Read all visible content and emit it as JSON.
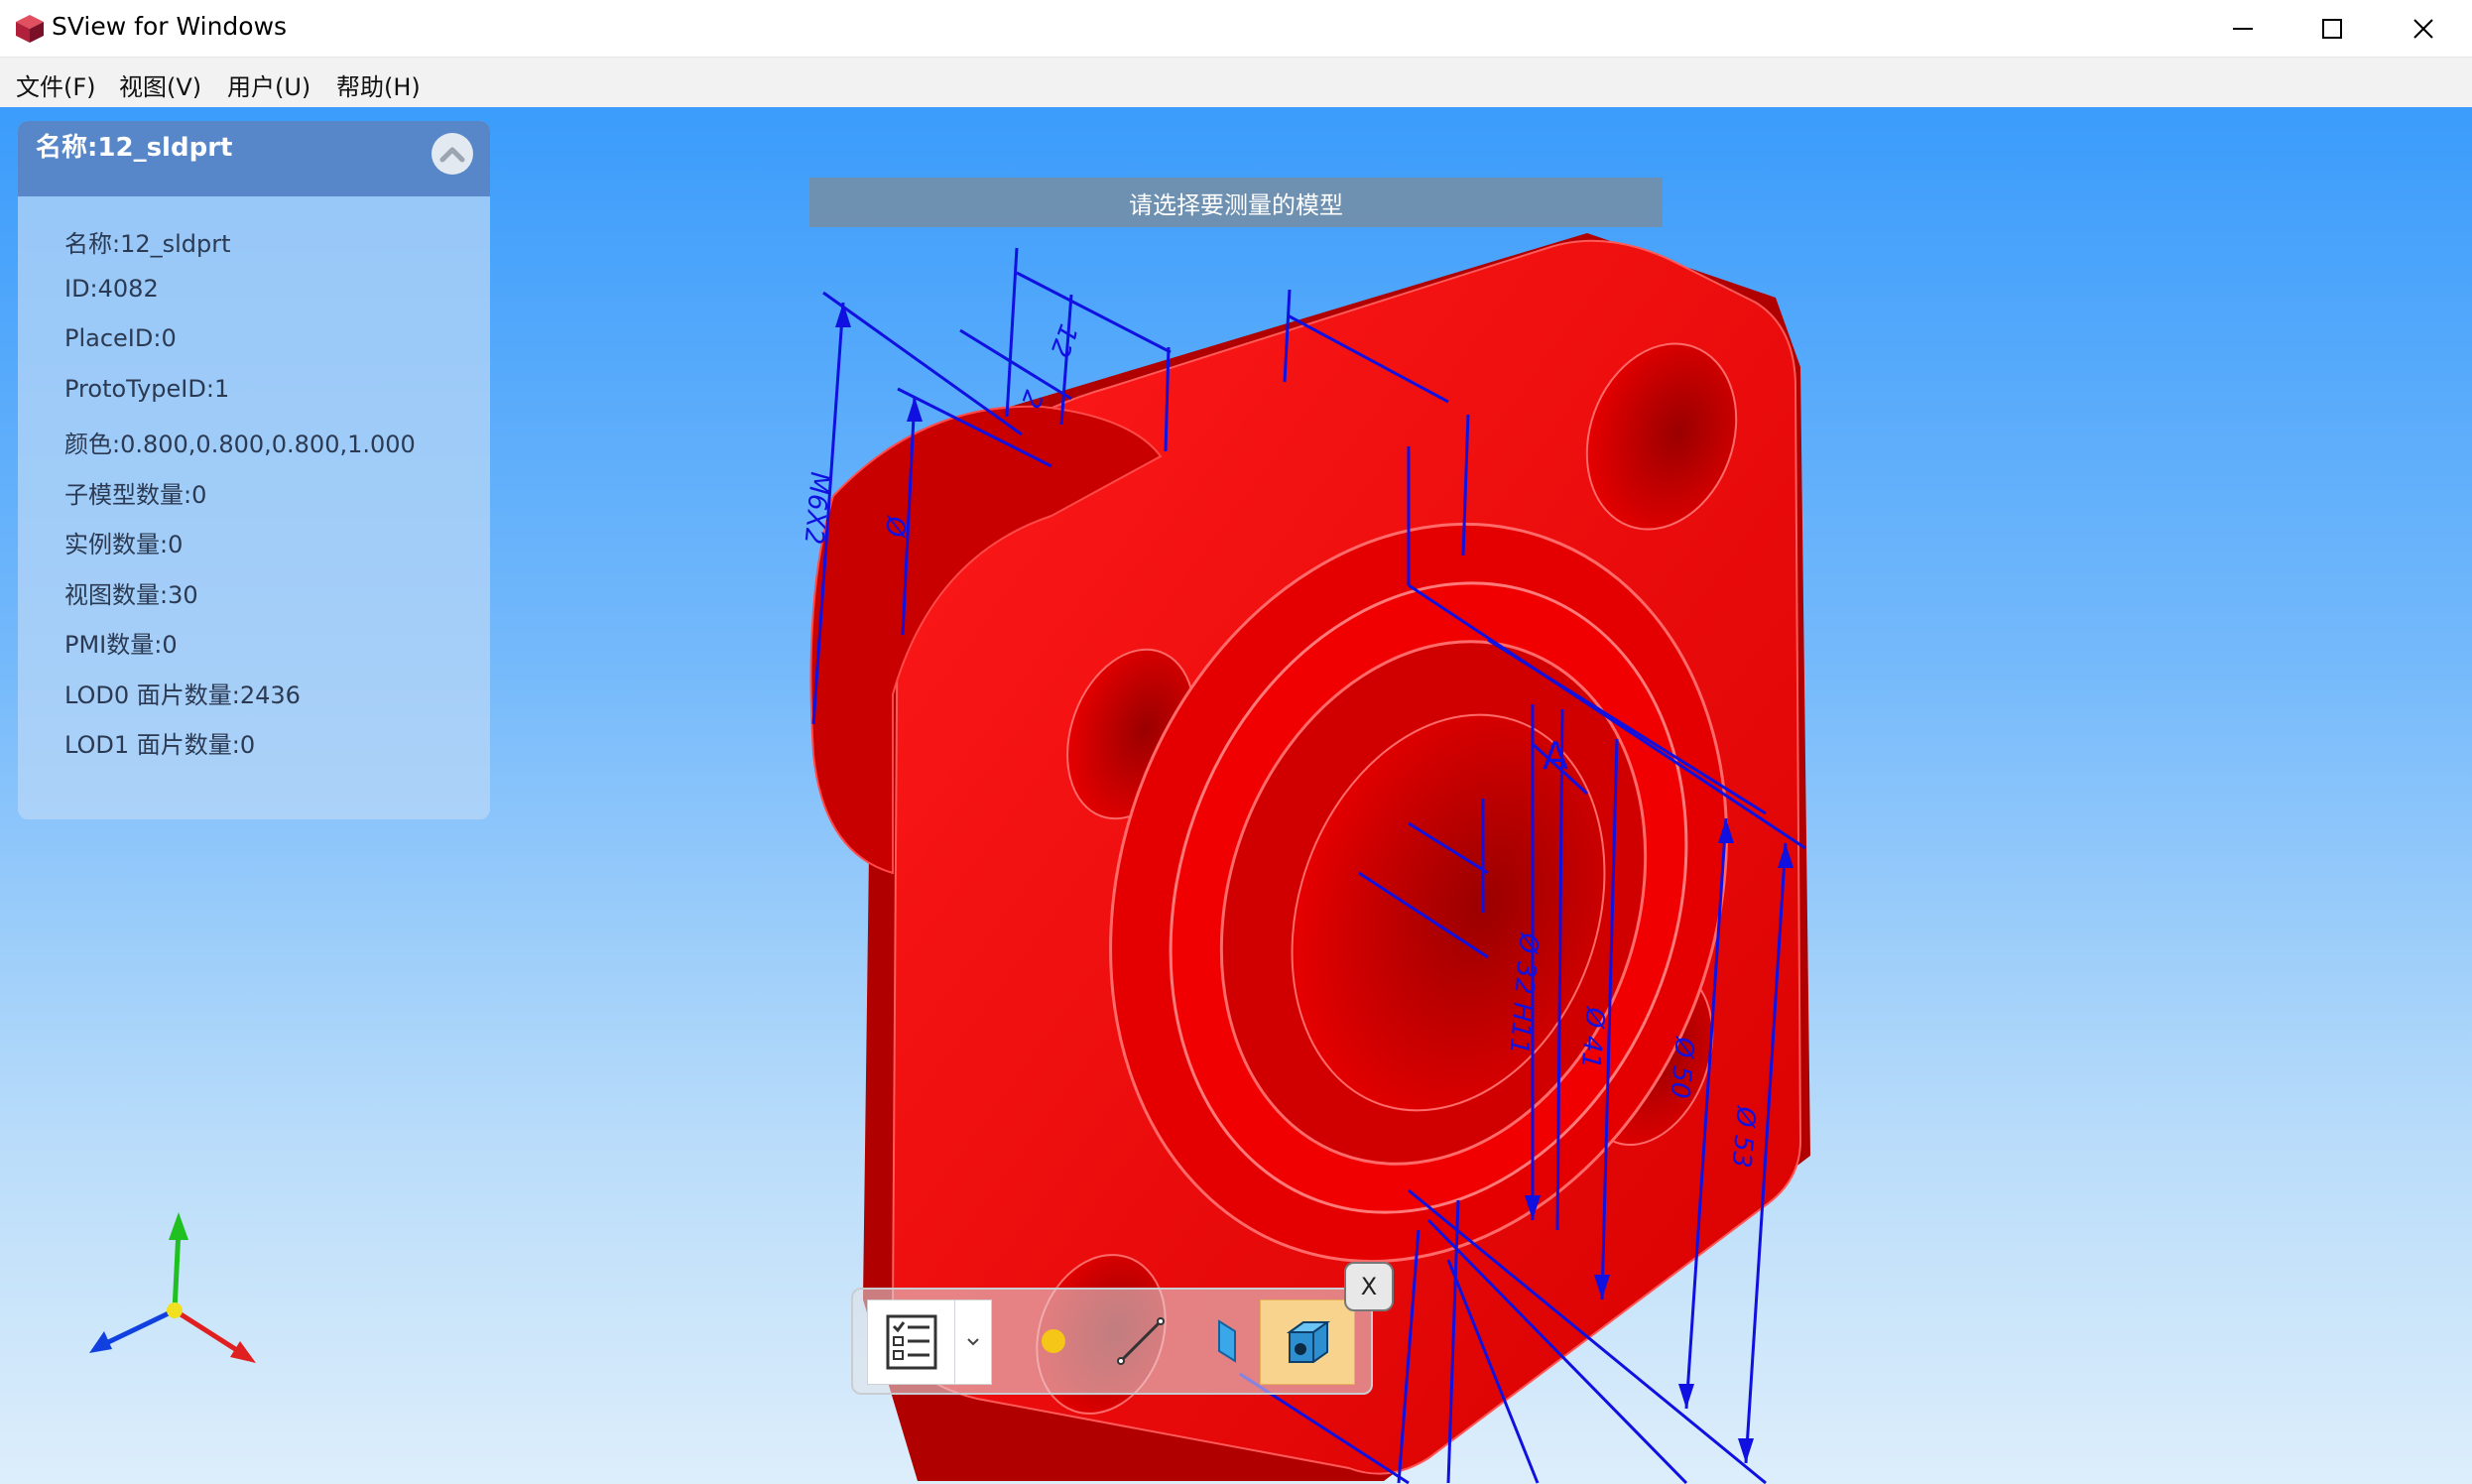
{
  "window": {
    "title": "SView for Windows",
    "icons": [
      "app-cube-icon",
      "minimize-icon",
      "maximize-icon",
      "close-icon"
    ]
  },
  "menu": [
    {
      "label": "文件(F)"
    },
    {
      "label": "视图(V)"
    },
    {
      "label": "用户(U)"
    },
    {
      "label": "帮助(H)"
    }
  ],
  "panel": {
    "title": "名称:12_sldprt",
    "collapse_icon": "chevron-up-icon",
    "properties": [
      "名称:12_sldprt",
      "ID:4082",
      "PlaceID:0",
      "ProtoTypeID:1",
      "颜色:0.800,0.800,0.800,1.000",
      "子模型数量:0",
      "实例数量:0",
      "视图数量:30",
      "PMI数量:0",
      "LOD0 面片数量:2436",
      "LOD1 面片数量:0"
    ]
  },
  "hint": "请选择要测量的模型",
  "toolbar": {
    "tools": [
      {
        "icon": "checklist-icon"
      },
      {
        "icon": "chevron-down-icon"
      },
      {
        "icon": "point-icon"
      },
      {
        "icon": "line-icon"
      },
      {
        "icon": "face-icon"
      },
      {
        "icon": "model-icon",
        "selected": true
      }
    ],
    "close_label": "X"
  },
  "annotations": [
    "12",
    "2",
    "M6X2",
    "Ø",
    "A",
    "Ø 32 H11",
    "Ø 41",
    "Ø 50",
    "Ø 53"
  ],
  "colors": {
    "model": "#e00000",
    "dimension": "#1010e0",
    "axis_x": "#e02020",
    "axis_y": "#20c020",
    "axis_z": "#1040e0"
  }
}
